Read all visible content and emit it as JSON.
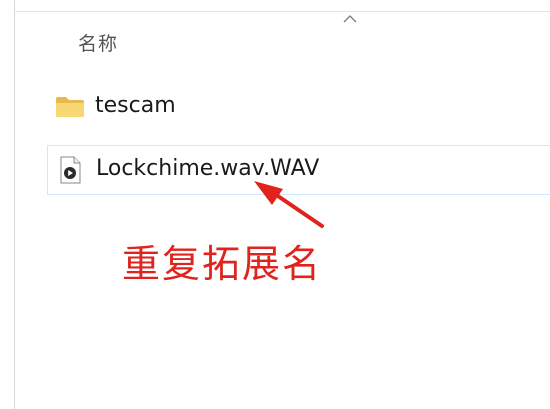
{
  "file_list": {
    "column_header": "名称",
    "sort_indicator_icon": "chevron-up-icon",
    "items": [
      {
        "name": "tescam",
        "type": "folder",
        "icon": "folder-icon"
      },
      {
        "name": "Lockchime.wav.WAV",
        "type": "audio-file",
        "icon": "audio-file-icon",
        "selected": true
      }
    ]
  },
  "annotation": {
    "text": "重复拓展名",
    "color": "#e0231c"
  },
  "colors": {
    "selection_border": "#cde8ff",
    "folder": "#f8d775"
  }
}
